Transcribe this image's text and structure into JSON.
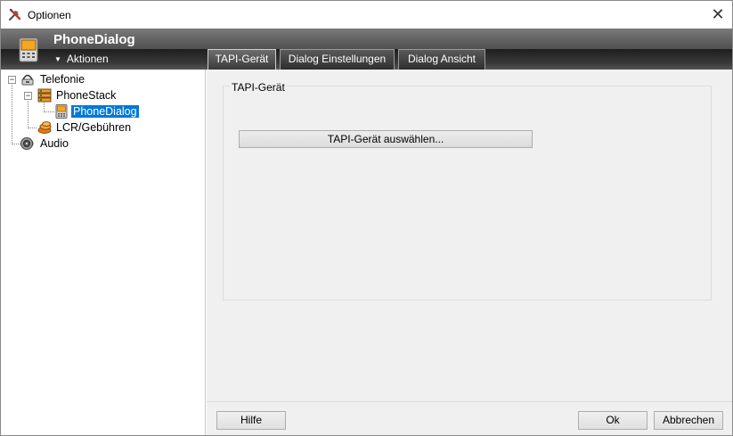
{
  "window": {
    "title": "Optionen",
    "close_glyph": "✕"
  },
  "header": {
    "app_title": "PhoneDialog",
    "actions_label": "Aktionen",
    "actions_arrow": "▼",
    "tabs": [
      {
        "label": "TAPI-Gerät",
        "active": true
      },
      {
        "label": "Dialog Einstellungen",
        "active": false
      },
      {
        "label": "Dialog Ansicht",
        "active": false
      }
    ]
  },
  "tree": {
    "items": [
      {
        "label": "Telefonie",
        "icon": "telephone-icon",
        "expanded": true
      },
      {
        "label": "PhoneStack",
        "icon": "phonestack-icon",
        "expanded": true
      },
      {
        "label": "PhoneDialog",
        "icon": "phonedialog-icon",
        "selected": true
      },
      {
        "label": "LCR/Gebühren",
        "icon": "coins-icon"
      },
      {
        "label": "Audio",
        "icon": "speaker-icon"
      }
    ],
    "expand_glyph": "−"
  },
  "content": {
    "group_title": "TAPI-Gerät",
    "select_device_button": "TAPI-Gerät auswählen..."
  },
  "footer": {
    "help_label": "Hilfe",
    "ok_label": "Ok",
    "cancel_label": "Abbrechen"
  },
  "colors": {
    "selection": "#0078d7",
    "header_dark": "#2a2a2a",
    "content_bg": "#f0f0f0"
  }
}
